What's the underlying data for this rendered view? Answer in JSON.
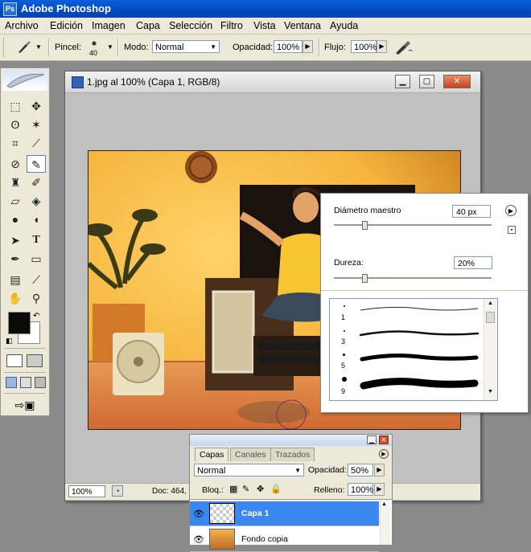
{
  "app": {
    "title": "Adobe Photoshop",
    "icon": "photoshop-icon"
  },
  "menu": [
    "Archivo",
    "Edición",
    "Imagen",
    "Capa",
    "Selección",
    "Filtro",
    "Vista",
    "Ventana",
    "Ayuda"
  ],
  "options": {
    "brush_label": "Pincel:",
    "brush_size": "40",
    "mode_label": "Modo:",
    "mode_value": "Normal",
    "opacity_label": "Opacidad:",
    "opacity_value": "100%",
    "flow_label": "Flujo:",
    "flow_value": "100%"
  },
  "document": {
    "title": "1.jpg al 100% (Capa 1, RGB/8)",
    "zoom": "100%",
    "info": "Doc: 464,"
  },
  "brush_popup": {
    "diameter_label": "Diámetro maestro",
    "diameter_value": "40 px",
    "diameter_level": 0.2,
    "hardness_label": "Dureza:",
    "hardness_value": "20%",
    "hardness_level": 0.2,
    "presets": [
      {
        "size": "1"
      },
      {
        "size": "3"
      },
      {
        "size": "5"
      },
      {
        "size": "9"
      }
    ]
  },
  "layers_panel": {
    "tabs": [
      "Capas",
      "Canales",
      "Trazados"
    ],
    "active_tab": "Capas",
    "blend_mode": "Normal",
    "opacity_label": "Opacidad:",
    "opacity_value": "50%",
    "lock_label": "Bloq.:",
    "fill_label": "Relleno:",
    "fill_value": "100%",
    "layers": [
      {
        "name": "Capa 1",
        "selected": true
      },
      {
        "name": "Fondo copia",
        "selected": false
      }
    ]
  },
  "colors": {
    "titlebar": "#0a5fd8",
    "selection": "#3a87f0",
    "foreground": "#0d0b07",
    "background": "#ffffff"
  }
}
